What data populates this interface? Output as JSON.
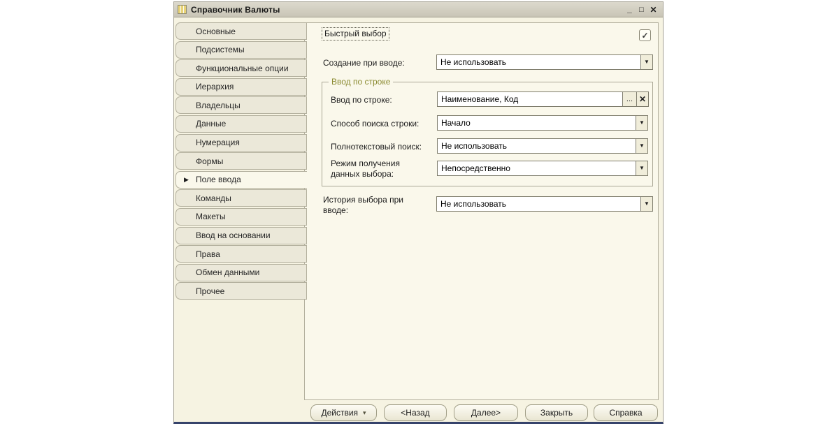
{
  "window": {
    "title": "Справочник Валюты",
    "controls": {
      "minimize": "_",
      "maximize": "□",
      "close": "✕"
    }
  },
  "icons": {
    "active_tab_marker": "▶",
    "dropdown_arrow": "▼",
    "check_mark": "✓",
    "menu_arrow": "▾"
  },
  "tabs": {
    "items": [
      {
        "label": "Основные"
      },
      {
        "label": "Подсистемы"
      },
      {
        "label": "Функциональные опции"
      },
      {
        "label": "Иерархия"
      },
      {
        "label": "Владельцы"
      },
      {
        "label": "Данные"
      },
      {
        "label": "Нумерация"
      },
      {
        "label": "Формы"
      },
      {
        "label": "Поле ввода",
        "active": true
      },
      {
        "label": "Команды"
      },
      {
        "label": "Макеты"
      },
      {
        "label": "Ввод на основании"
      },
      {
        "label": "Права"
      },
      {
        "label": "Обмен данными"
      },
      {
        "label": "Прочее"
      }
    ]
  },
  "form": {
    "quick_choice_label": "Быстрый выбор",
    "quick_choice_checked": true,
    "creation_label": "Создание при вводе:",
    "creation_value": "Не использовать",
    "group_title": "Ввод по строке",
    "input_by_string_label": "Ввод по строке:",
    "input_by_string_value": "Наименование, Код",
    "ellipsis_button": "...",
    "clear_button": "✕",
    "search_method_label": "Способ поиска строки:",
    "search_method_value": "Начало",
    "fulltext_label": "Полнотекстовый поиск:",
    "fulltext_value": "Не использовать",
    "mode_label": "Режим получения данных выбора:",
    "mode_value": "Непосредственно",
    "history_label": "История выбора при вводе:",
    "history_value": "Не использовать"
  },
  "footer": {
    "actions_label": "Действия",
    "back_label": "<Назад",
    "next_label": "Далее>",
    "close_label": "Закрыть",
    "help_label": "Справка"
  }
}
